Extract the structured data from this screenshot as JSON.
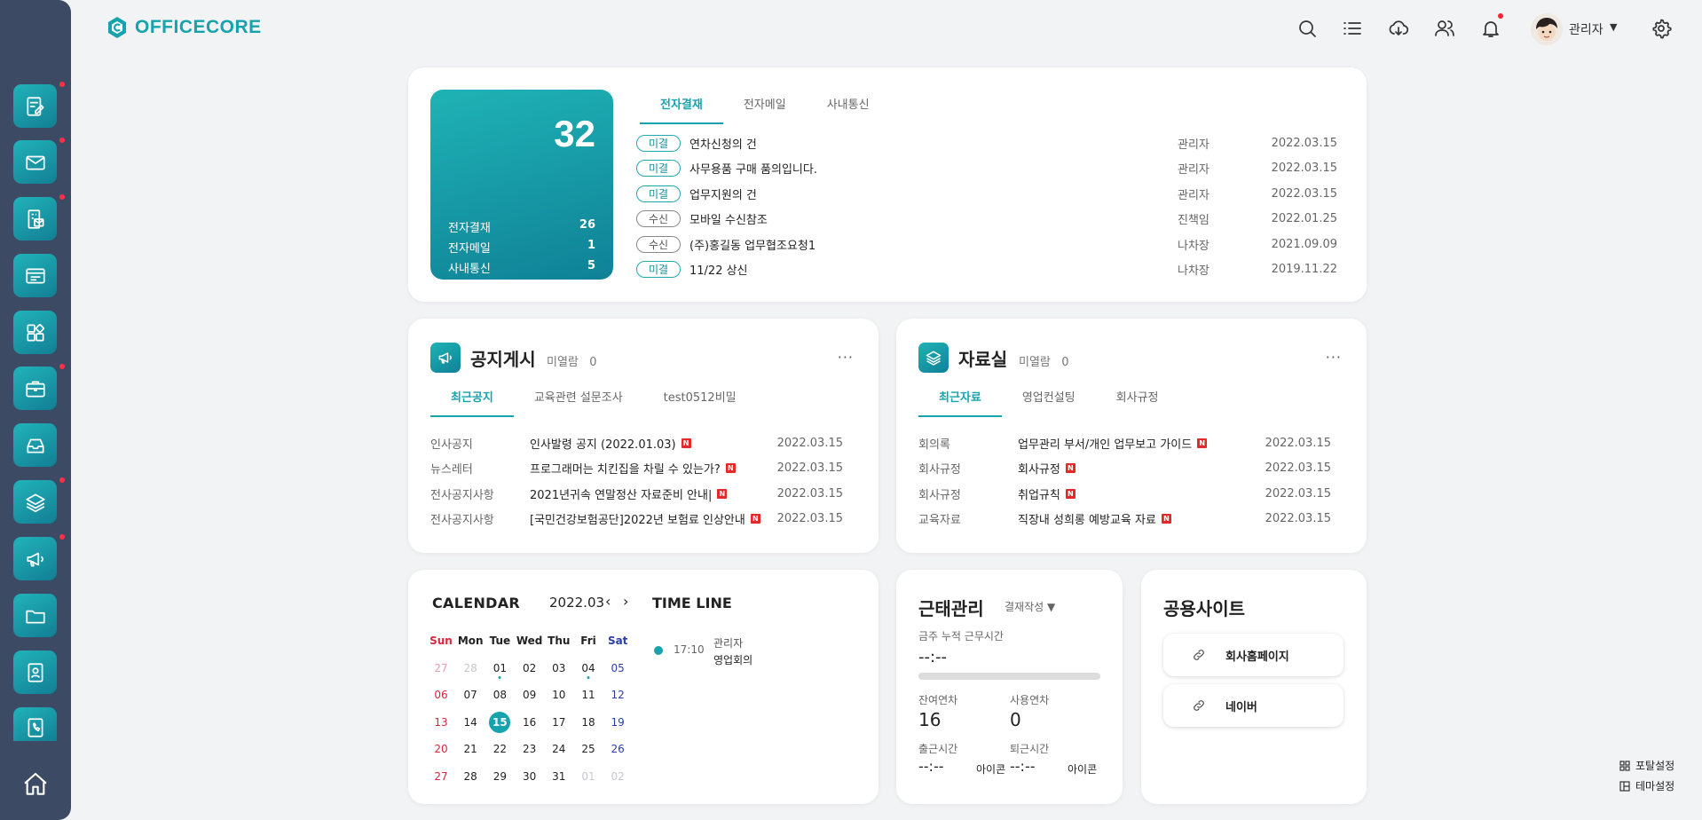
{
  "app": {
    "logo_text": "OFFICECORE",
    "accent_color": "#17a3ad",
    "sidebar_color": "#3d4a63"
  },
  "sidebar": {
    "items": [
      {
        "icon": "edit-document-icon",
        "dot": true
      },
      {
        "icon": "mail-icon",
        "dot": true
      },
      {
        "icon": "building-mail-icon",
        "dot": true
      },
      {
        "icon": "list-window-icon",
        "dot": false
      },
      {
        "icon": "apps-grid-icon",
        "dot": false
      },
      {
        "icon": "briefcase-icon",
        "dot": true
      },
      {
        "icon": "inbox-tray-icon",
        "dot": false
      },
      {
        "icon": "layers-icon",
        "dot": true
      },
      {
        "icon": "megaphone-icon",
        "dot": true
      },
      {
        "icon": "folder-icon",
        "dot": false
      },
      {
        "icon": "contact-book-icon",
        "dot": false
      },
      {
        "icon": "phone-book-icon",
        "dot": false
      }
    ],
    "home_icon": "home-icon"
  },
  "header": {
    "icons": [
      "search-icon",
      "list-icon",
      "cloud-download-icon",
      "users-icon",
      "bell-icon",
      "gear-icon"
    ],
    "user_name": "관리자",
    "user_caret": "▼"
  },
  "approval": {
    "total": "32",
    "counts": [
      {
        "label": "전자결재",
        "value": "26"
      },
      {
        "label": "전자메일",
        "value": "1"
      },
      {
        "label": "사내통신",
        "value": "5"
      }
    ],
    "tabs": [
      "전자결재",
      "전자메일",
      "사내통신"
    ],
    "active_tab": 0,
    "rows": [
      {
        "status": "미결",
        "title": "연차신청의 건",
        "user": "관리자",
        "date": "2022.03.15"
      },
      {
        "status": "미결",
        "title": "사무용품 구매 품의입니다.",
        "user": "관리자",
        "date": "2022.03.15"
      },
      {
        "status": "미결",
        "title": "업무지원의 건",
        "user": "관리자",
        "date": "2022.03.15"
      },
      {
        "status": "수신",
        "title": "모바일 수신참조",
        "user": "진책임",
        "date": "2022.01.25"
      },
      {
        "status": "수신",
        "title": "(주)홍길동 업무협조요청1",
        "user": "나차장",
        "date": "2021.09.09"
      },
      {
        "status": "미결",
        "title": "11/22 상신",
        "user": "나차장",
        "date": "2019.11.22"
      }
    ]
  },
  "notice": {
    "title": "공지게시",
    "unread_label": "미열람",
    "unread_count": "0",
    "more": "···",
    "tabs": [
      "최근공지",
      "교육관련 설문조사",
      "test0512비밀"
    ],
    "active_tab": 0,
    "new_badge": "N",
    "rows": [
      {
        "category": "인사공지",
        "title": "인사발령 공지 (2022.01.03)",
        "date": "2022.03.15"
      },
      {
        "category": "뉴스레터",
        "title": "프로그래머는 치킨집을 차릴 수 있는가?",
        "date": "2022.03.15"
      },
      {
        "category": "전사공지사항",
        "title": "2021년귀속 연말정산 자료준비 안내|",
        "date": "2022.03.15"
      },
      {
        "category": "전사공지사항",
        "title": "[국민건강보험공단]2022년 보험료 인상안내",
        "date": "2022.03.15"
      }
    ]
  },
  "archive": {
    "title": "자료실",
    "unread_label": "미열람",
    "unread_count": "0",
    "more": "···",
    "tabs": [
      "최근자료",
      "영업컨설팅",
      "회사규정"
    ],
    "active_tab": 0,
    "new_badge": "N",
    "rows": [
      {
        "category": "회의록",
        "title": "업무관리 부서/개인 업무보고 가이드",
        "date": "2022.03.15"
      },
      {
        "category": "회사규정",
        "title": "회사규정",
        "date": "2022.03.15"
      },
      {
        "category": "회사규정",
        "title": "취업규칙",
        "date": "2022.03.15"
      },
      {
        "category": "교육자료",
        "title": "직장내 성희롱 예방교육 자료",
        "date": "2022.03.15"
      }
    ]
  },
  "calendar": {
    "title": "CALENDAR",
    "month": "2022.03",
    "prev": "‹",
    "next": "›",
    "weekdays": [
      "Sun",
      "Mon",
      "Tue",
      "Wed",
      "Thu",
      "Fri",
      "Sat"
    ],
    "weeks": [
      [
        "27",
        "28",
        "01",
        "02",
        "03",
        "04",
        "05"
      ],
      [
        "06",
        "07",
        "08",
        "09",
        "10",
        "11",
        "12"
      ],
      [
        "13",
        "14",
        "15",
        "16",
        "17",
        "18",
        "19"
      ],
      [
        "20",
        "21",
        "22",
        "23",
        "24",
        "25",
        "26"
      ],
      [
        "27",
        "28",
        "29",
        "30",
        "31",
        "01",
        "02"
      ]
    ],
    "today": "15",
    "event_days": [
      "01",
      "04"
    ]
  },
  "timeline": {
    "title": "TIME LINE",
    "items": [
      {
        "time": "17:10",
        "user": "관리자",
        "event": "영업회의"
      }
    ]
  },
  "attendance": {
    "title": "근태관리",
    "mode": "결재작성 ▼",
    "weekly_label": "금주 누적 근무시간",
    "weekly_value": "--:--",
    "weekly_progress": 0,
    "remain_label": "잔여연차",
    "remain_value": "16",
    "used_label": "사용연차",
    "used_value": "0",
    "in_label": "출근시간",
    "in_value": "--:--",
    "in_icon": "아이콘",
    "out_label": "퇴근시간",
    "out_value": "--:--",
    "out_icon": "아이콘"
  },
  "links": {
    "title": "공용사이트",
    "items": [
      {
        "label": "회사홈페이지",
        "icon": "link-icon"
      },
      {
        "label": "네이버",
        "icon": "link-icon"
      }
    ]
  },
  "footer": {
    "portal_settings": "포탈설정",
    "theme_settings": "테마설정"
  }
}
